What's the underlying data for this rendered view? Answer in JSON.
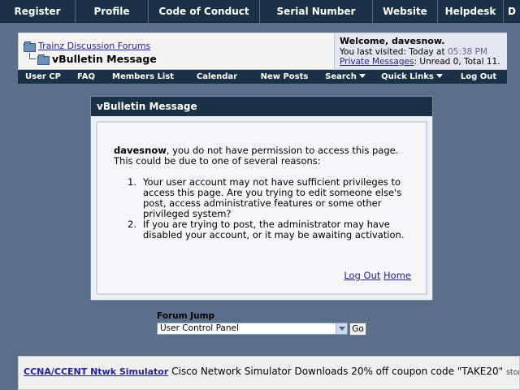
{
  "top_nav": [
    "Register",
    "Profile",
    "Code of Conduct",
    "Serial Number",
    "Website",
    "Helpdesk",
    "D"
  ],
  "breadcrumb": {
    "forum_link": "Trainz Discussion Forums",
    "current": "vBulletin Message"
  },
  "welcome": {
    "greeting": "Welcome, davesnow.",
    "last_visited_prefix": "You last visited: Today at",
    "last_visited_time": "05:38 PM",
    "pm_link": "Private Messages",
    "pm_status": ": Unread 0, Total 11."
  },
  "sub_nav": {
    "user_cp": "User CP",
    "faq": "FAQ",
    "members_list": "Members List",
    "calendar": "Calendar",
    "new_posts": "New Posts",
    "search": "Search",
    "quick_links": "Quick Links",
    "log_out": "Log Out"
  },
  "message": {
    "title": "vBulletin Message",
    "username": "davesnow",
    "intro": ", you do not have permission to access this page. This could be due to one of several reasons:",
    "reasons": [
      {
        "num": "1.",
        "text": "Your user account may not have sufficient privileges to access this page. Are you trying to edit someone else's post, access administrative features or some other privileged system?"
      },
      {
        "num": "2.",
        "text": "If you are trying to post, the administrator may have disabled your account, or it may be awaiting activation."
      }
    ],
    "logout_link": "Log Out",
    "home_link": "Home"
  },
  "forum_jump": {
    "label": "Forum Jump",
    "selected": "User Control Panel",
    "go": "Go"
  },
  "ad": {
    "link": "CCNA/CCENT Ntwk Simulator",
    "text": "Cisco Network Simulator Downloads 20% off coupon code \"TAKE20\"",
    "url": "store.pe"
  }
}
